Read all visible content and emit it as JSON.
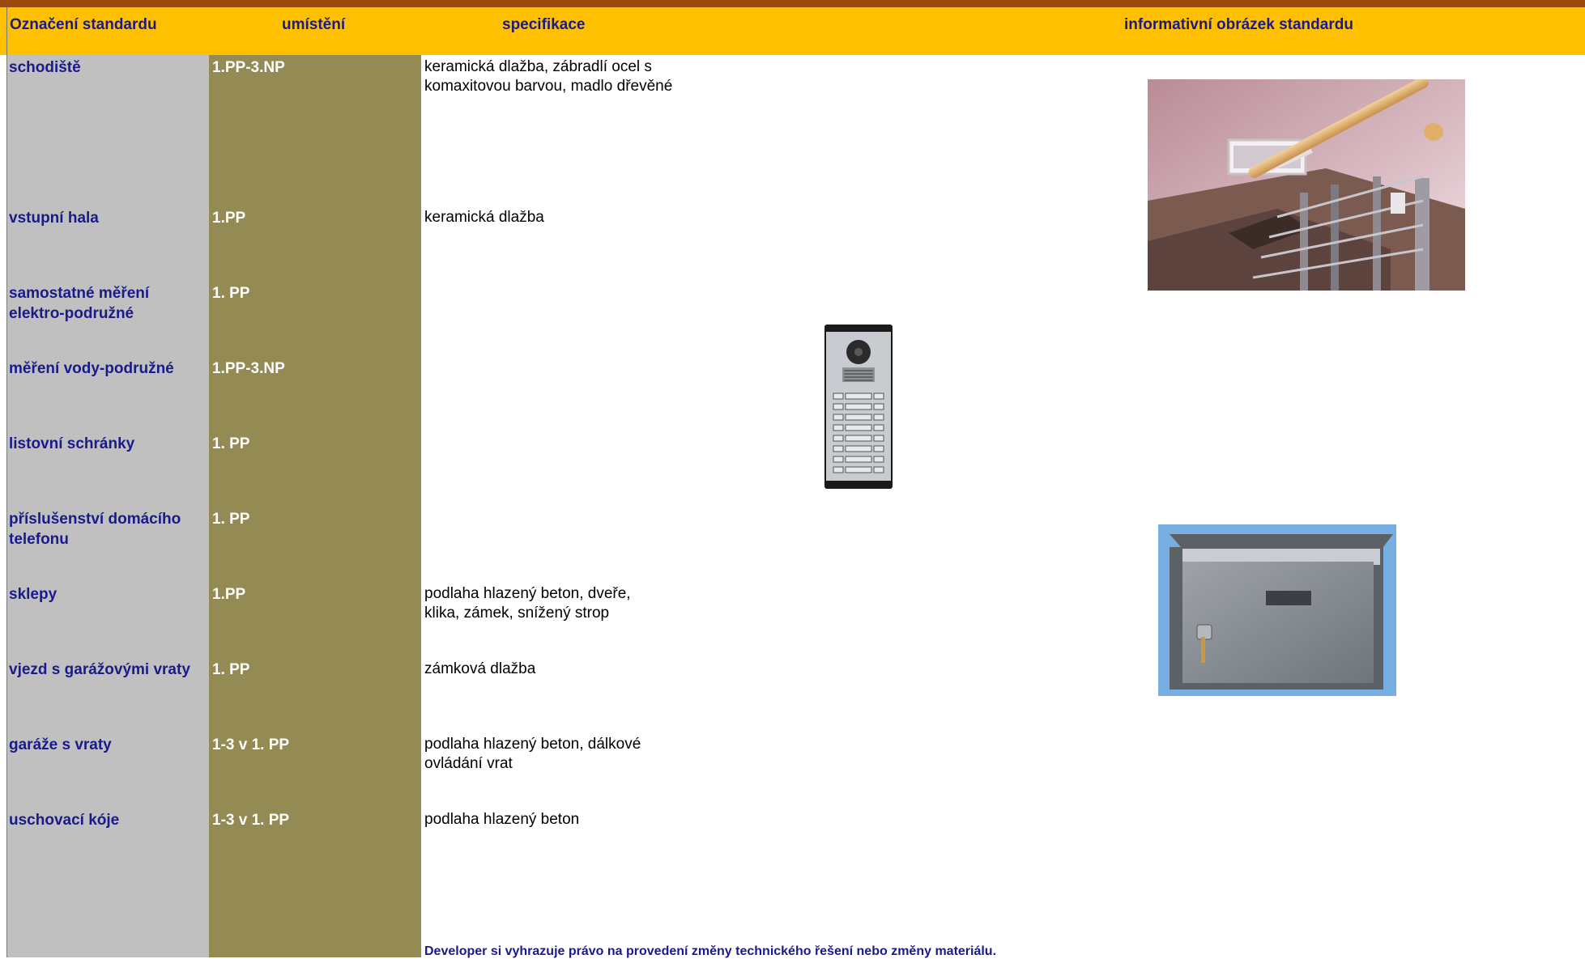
{
  "header": {
    "col_name": "Označení standardu",
    "col_location": "umístění",
    "col_spec": "specifikace",
    "col_image": "informativní obrázek standardu"
  },
  "rows": [
    {
      "name": "schodiště",
      "location": "1.PP-3.NP",
      "spec": "keramická dlažba, zábradlí ocel s komaxitovou barvou, madlo dřevěné"
    },
    {
      "name": "vstupní hala",
      "location": "1.PP",
      "spec": "keramická dlažba"
    },
    {
      "name": "samostatné měření elektro-podružné",
      "location": "1. PP",
      "spec": ""
    },
    {
      "name": "měření vody-podružné",
      "location": "1.PP-3.NP",
      "spec": ""
    },
    {
      "name": "listovní schránky",
      "location": "1. PP",
      "spec": ""
    },
    {
      "name": "příslušenství domácího telefonu",
      "location": "1. PP",
      "spec": ""
    },
    {
      "name": "sklepy",
      "location": "1.PP",
      "spec": "podlaha hlazený beton, dveře, klika, zámek, snížený strop"
    },
    {
      "name": "vjezd s garážovými vraty",
      "location": "1. PP",
      "spec": "zámková dlažba"
    },
    {
      "name": "garáže s vraty",
      "location": "1-3 v 1. PP",
      "spec": "podlaha hlazený beton, dálkové ovládání vrat"
    },
    {
      "name": "uschovací kóje",
      "location": "1-3 v 1. PP",
      "spec": "podlaha hlazený beton"
    }
  ],
  "footer": {
    "note": "Developer si vyhrazuje právo na provedení  změny technického řešení nebo změny materiálu."
  },
  "colors": {
    "topbar": "#9a4a0b",
    "header": "#ffc000",
    "col_name_bg": "#c0c0c0",
    "col_location_bg": "#948a54",
    "name_text": "#1a1a8a"
  }
}
